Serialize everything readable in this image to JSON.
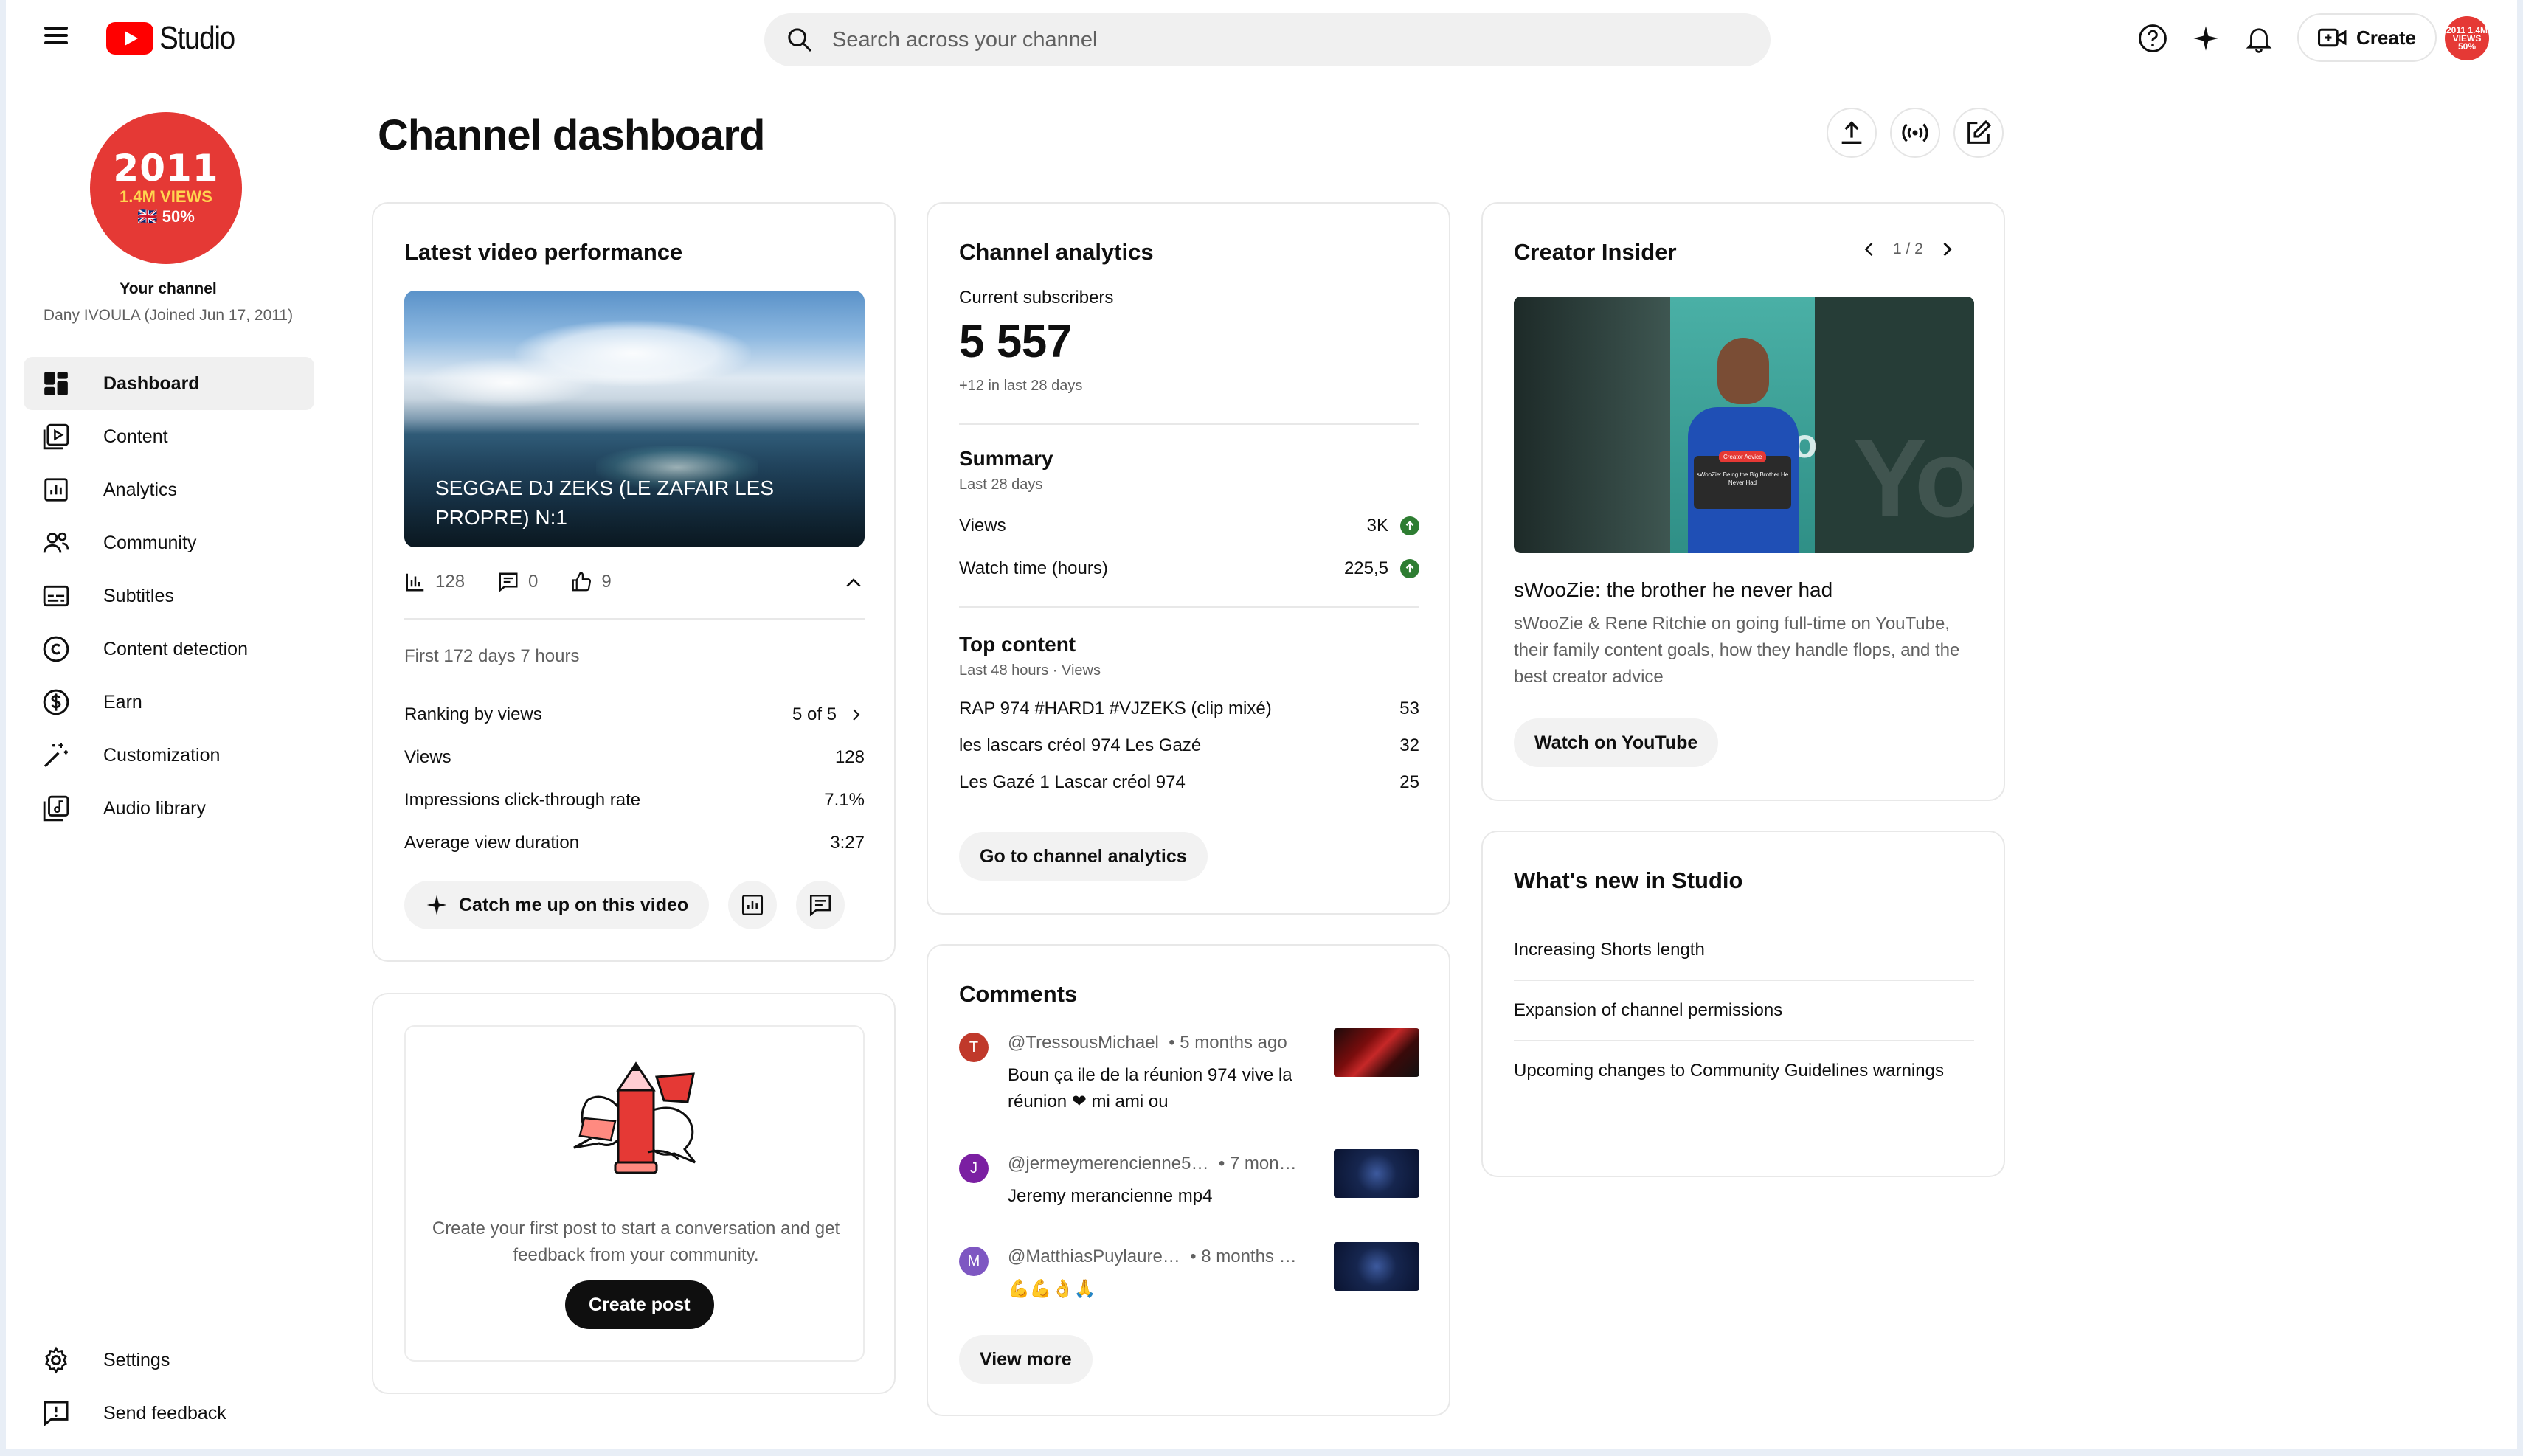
{
  "app": {
    "logo_text": "Studio"
  },
  "search": {
    "placeholder": "Search across your channel"
  },
  "header": {
    "create_label": "Create",
    "avatar_text": "2011 1.4M VIEWS 50%"
  },
  "channel": {
    "avatar_year": "2011",
    "avatar_views": "1.4M VIEWS",
    "avatar_pct": "🇬🇧 50%",
    "label": "Your channel",
    "owner": "Dany IVOULA (Joined Jun 17, 2011)"
  },
  "sidebar": {
    "items": [
      {
        "label": "Dashboard",
        "icon": "dashboard-icon",
        "active": true
      },
      {
        "label": "Content",
        "icon": "content-icon"
      },
      {
        "label": "Analytics",
        "icon": "analytics-icon"
      },
      {
        "label": "Community",
        "icon": "community-icon"
      },
      {
        "label": "Subtitles",
        "icon": "subtitles-icon"
      },
      {
        "label": "Content detection",
        "icon": "copyright-icon"
      },
      {
        "label": "Earn",
        "icon": "dollar-icon"
      },
      {
        "label": "Customization",
        "icon": "magic-wand-icon"
      },
      {
        "label": "Audio library",
        "icon": "audio-library-icon"
      }
    ],
    "bottom": [
      {
        "label": "Settings",
        "icon": "gear-icon"
      },
      {
        "label": "Send feedback",
        "icon": "feedback-icon"
      }
    ]
  },
  "page": {
    "title": "Channel dashboard"
  },
  "latest_video": {
    "heading": "Latest video performance",
    "video_title": "SEGGAE DJ ZEKS (LE ZAFAIR LES PROPRE) N:1",
    "views_count": "128",
    "comments_count": "0",
    "likes_count": "9",
    "first_period": "First 172 days 7 hours",
    "rows": [
      {
        "label": "Ranking by views",
        "value": "5 of 5"
      },
      {
        "label": "Views",
        "value": "128"
      },
      {
        "label": "Impressions click-through rate",
        "value": "7.1%"
      },
      {
        "label": "Average view duration",
        "value": "3:27"
      }
    ],
    "catch_up_label": "Catch me up on this video"
  },
  "post": {
    "text": "Create your first post to start a conversation and get feedback from your community.",
    "button_label": "Create post"
  },
  "analytics": {
    "heading": "Channel analytics",
    "subscribers_label": "Current subscribers",
    "subscribers_value": "5 557",
    "subscribers_delta": "+12 in last 28 days",
    "summary_heading": "Summary",
    "summary_period": "Last 28 days",
    "summary_rows": [
      {
        "label": "Views",
        "value": "3K"
      },
      {
        "label": "Watch time (hours)",
        "value": "225,5"
      }
    ],
    "top_heading": "Top content",
    "top_period": "Last 48 hours · Views",
    "top_rows": [
      {
        "label": "RAP 974 #HARD1 #VJZEKS (clip mixé)",
        "value": "53"
      },
      {
        "label": "les lascars créol 974 Les Gazé",
        "value": "32"
      },
      {
        "label": "Les Gazé 1 Lascar créol 974",
        "value": "25"
      }
    ],
    "button_label": "Go to channel analytics"
  },
  "comments": {
    "heading": "Comments",
    "items": [
      {
        "initial": "T",
        "color": "#c0392b",
        "author": "@TressousMichael",
        "time": "• 5 months ago",
        "text": "Boun ça ile de la réunion 974 vive la réunion ❤ mi ami ou"
      },
      {
        "initial": "J",
        "color": "#7b1fa2",
        "author": "@jermeymerencienne5…",
        "time": "• 7 mon…",
        "text": "Jeremy merancienne mp4"
      },
      {
        "initial": "M",
        "color": "#7e57c2",
        "author": "@MatthiasPuylaure…",
        "time": "• 8 months …",
        "text": "💪💪👌🙏"
      }
    ],
    "view_more_label": "View more"
  },
  "insider": {
    "heading": "Creator Insider",
    "pager": "1 / 2",
    "badge_text": "sWooZie: Being the Big Brother He Never Had",
    "title": "sWooZie: the brother he never had",
    "description": "sWooZie & Rene Ritchie on going full-time on YouTube, their family content goals, how they handle flops, and the best creator advice",
    "button_label": "Watch on YouTube"
  },
  "whats_new": {
    "heading": "What's new in Studio",
    "items": [
      "Increasing Shorts length",
      "Expansion of channel permissions",
      "Upcoming changes to Community Guidelines warnings"
    ]
  },
  "colors": {
    "brand": "#ff0000",
    "avatar": "#e53935",
    "positive": "#2e7d32"
  }
}
